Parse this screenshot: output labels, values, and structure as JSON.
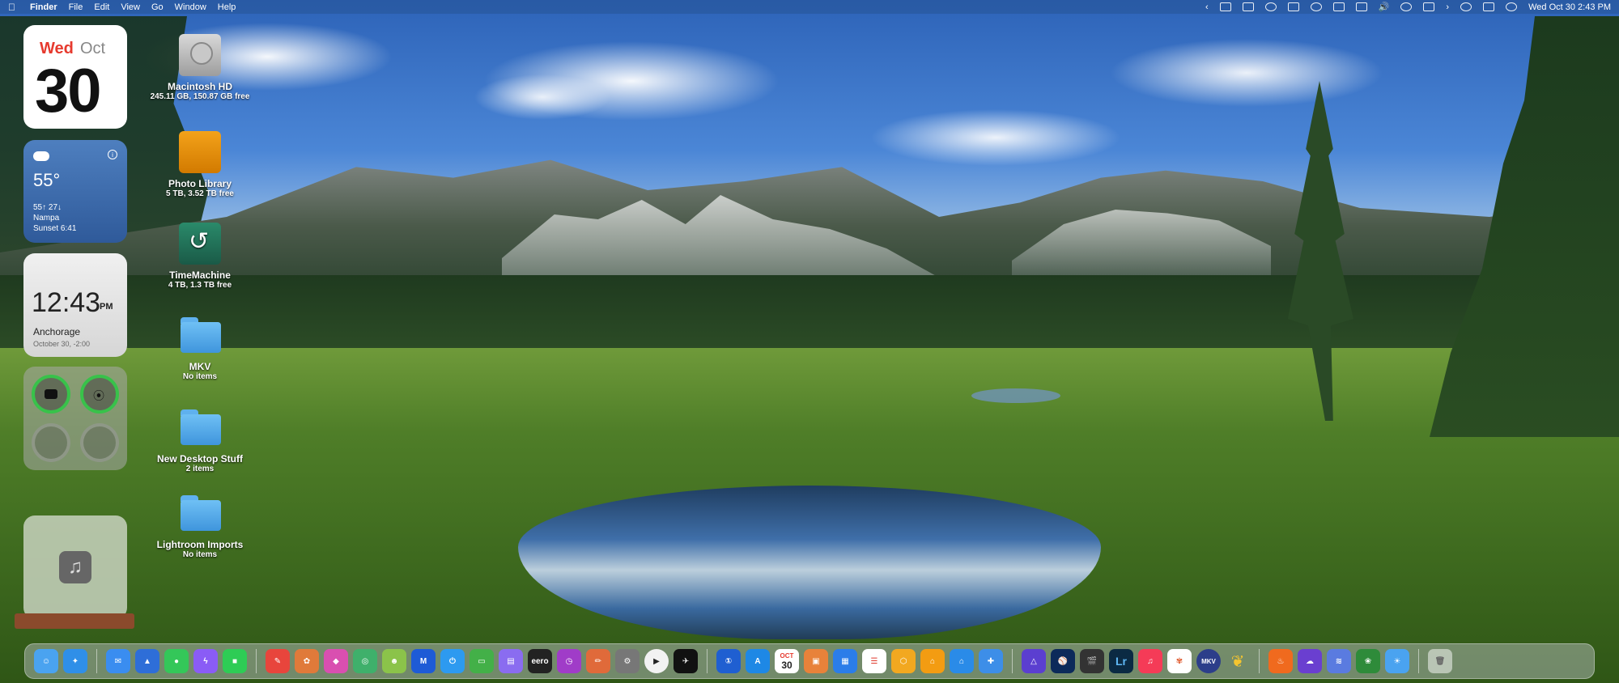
{
  "menubar": {
    "apple": "",
    "app_name": "Finder",
    "menus": [
      "File",
      "Edit",
      "View",
      "Go",
      "Window",
      "Help"
    ],
    "clock": "Wed Oct 30  2:43 PM"
  },
  "widgets": {
    "calendar": {
      "weekday": "Wed",
      "month": "Oct",
      "date": "30"
    },
    "weather": {
      "temp": "55°",
      "hilo": "55↑ 27↓",
      "location": "Nampa",
      "sunset": "Sunset 6:41"
    },
    "clock": {
      "time": "12:43",
      "ampm": "PM",
      "city": "Anchorage",
      "sub": "October 30, -2:00"
    }
  },
  "desktop_icons": [
    {
      "name": "Macintosh HD",
      "meta": "245.11 GB, 150.87 GB free",
      "icon": "hard-drive-icon"
    },
    {
      "name": "Photo Library",
      "meta": "5 TB, 3.52 TB free",
      "icon": "external-drive-icon"
    },
    {
      "name": "TimeMachine",
      "meta": "4 TB, 1.3 TB free",
      "icon": "time-machine-drive-icon"
    },
    {
      "name": "MKV",
      "meta": "No items",
      "icon": "folder-icon"
    },
    {
      "name": "New Desktop Stuff",
      "meta": "2 items",
      "icon": "folder-icon"
    },
    {
      "name": "Lightroom Imports",
      "meta": "No items",
      "icon": "folder-icon"
    }
  ],
  "dock": {
    "text_labels": {
      "eero": "eero",
      "lr": "Lr",
      "mkv": "MKV",
      "calendar_mon": "OCT",
      "calendar_day": "30"
    }
  }
}
